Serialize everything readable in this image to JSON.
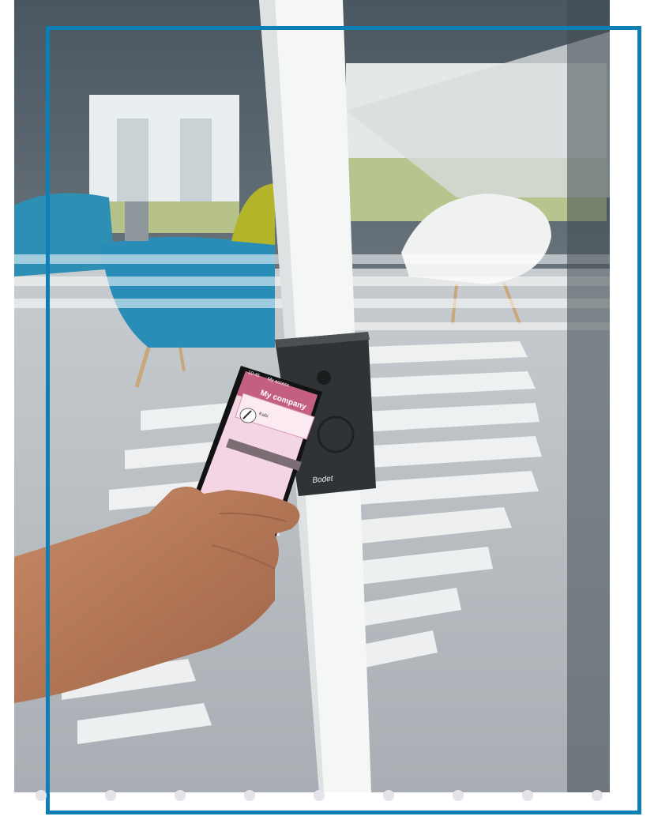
{
  "phone": {
    "status_time": "10:45",
    "top_title": "My access",
    "company_title": "My company",
    "access_label": "Kabi"
  },
  "reader": {
    "brand": "Bodet"
  },
  "colors": {
    "frame": "#0e7fb4",
    "screen_bg": "#f6d8e6",
    "app_header": "#c25a7e"
  }
}
